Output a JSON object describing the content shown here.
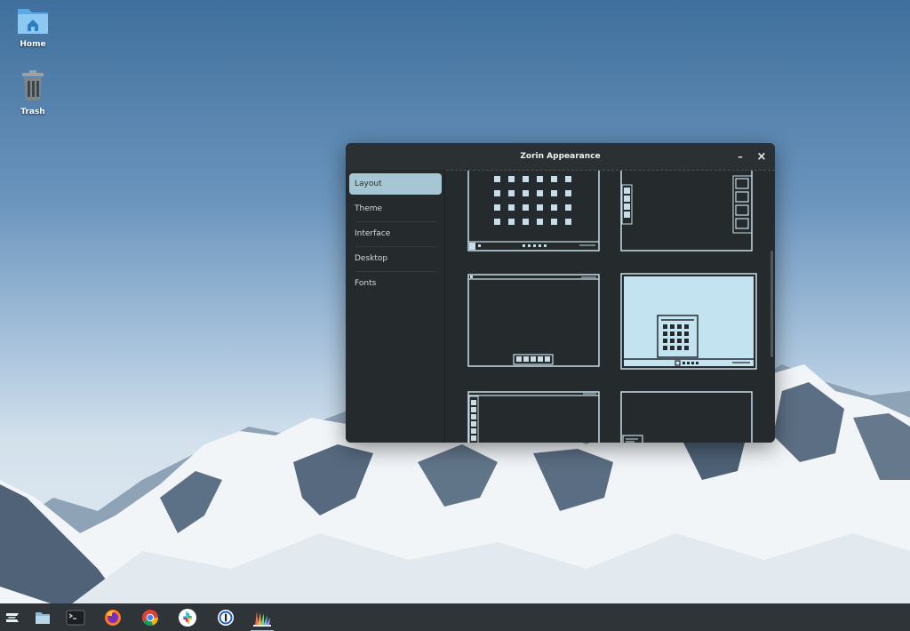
{
  "desktop": {
    "icons": [
      {
        "label": "Home"
      },
      {
        "label": "Trash"
      }
    ]
  },
  "window": {
    "title": "Zorin Appearance",
    "minimize_symbol": "–",
    "close_symbol": "×"
  },
  "sidebar": {
    "items": [
      {
        "label": "Layout",
        "active": true
      },
      {
        "label": "Theme"
      },
      {
        "label": "Interface"
      },
      {
        "label": "Desktop"
      },
      {
        "label": "Fonts"
      }
    ]
  },
  "layouts": {
    "selected_index": 3,
    "count": 6
  },
  "taskbar": {
    "apps": [
      {
        "icon": "zorin-menu-icon"
      },
      {
        "icon": "files-icon"
      },
      {
        "icon": "terminal-icon"
      },
      {
        "icon": "firefox-icon"
      },
      {
        "icon": "chrome-icon"
      },
      {
        "icon": "slack-icon"
      },
      {
        "icon": "1password-icon"
      },
      {
        "icon": "zorin-appearance-icon",
        "active": true
      }
    ]
  },
  "colors": {
    "accent": "#a6c6d3",
    "window_bg": "#252a2d",
    "line": "#c8dde6",
    "selected_fill": "#c4e3f0",
    "taskbar": "#2e3438"
  }
}
